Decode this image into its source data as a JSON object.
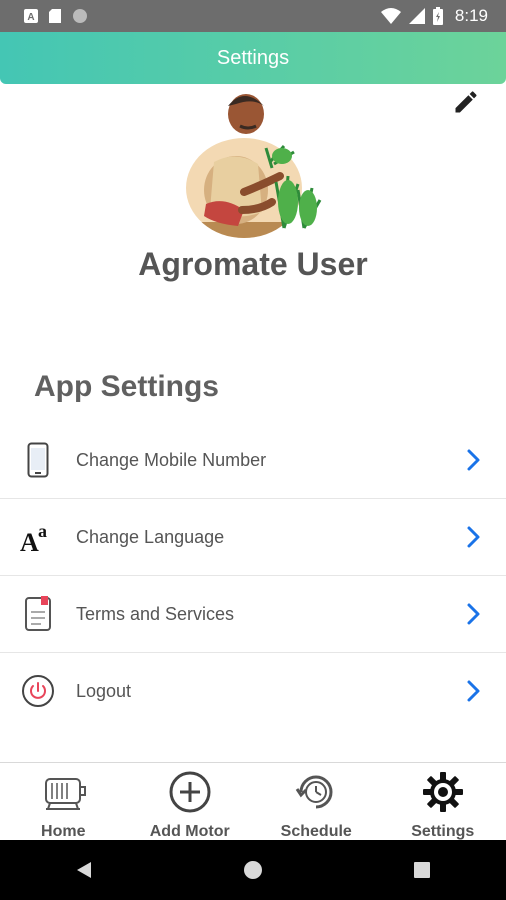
{
  "status_bar": {
    "time": "8:19",
    "icons": [
      "a-notification-icon",
      "sd-card-icon",
      "circle-notification-icon",
      "wifi-icon",
      "signal-icon",
      "battery-icon"
    ]
  },
  "header": {
    "title": "Settings"
  },
  "profile": {
    "name": "Agromate User",
    "edit_icon": "pencil-icon",
    "avatar": "farmer-planting-avatar"
  },
  "app_settings": {
    "title": "App Settings",
    "items": [
      {
        "label": "Change Mobile Number",
        "icon": "mobile-phone-icon"
      },
      {
        "label": "Change Language",
        "icon": "language-icon"
      },
      {
        "label": "Terms and Services",
        "icon": "document-icon"
      },
      {
        "label": "Logout",
        "icon": "power-icon"
      }
    ]
  },
  "bottom_nav": {
    "items": [
      {
        "label": "Home",
        "icon": "motor-icon"
      },
      {
        "label": "Add Motor",
        "icon": "add-circle-icon"
      },
      {
        "label": "Schedule",
        "icon": "schedule-clock-icon"
      },
      {
        "label": "Settings",
        "icon": "gear-icon"
      }
    ],
    "active": "Settings"
  },
  "colors": {
    "header_gradient_start": "#44c6b4",
    "header_gradient_end": "#6cd39a",
    "chevron": "#1a73e8",
    "logout_icon": "#e8455a",
    "status_bar": "#6d6d6d"
  }
}
